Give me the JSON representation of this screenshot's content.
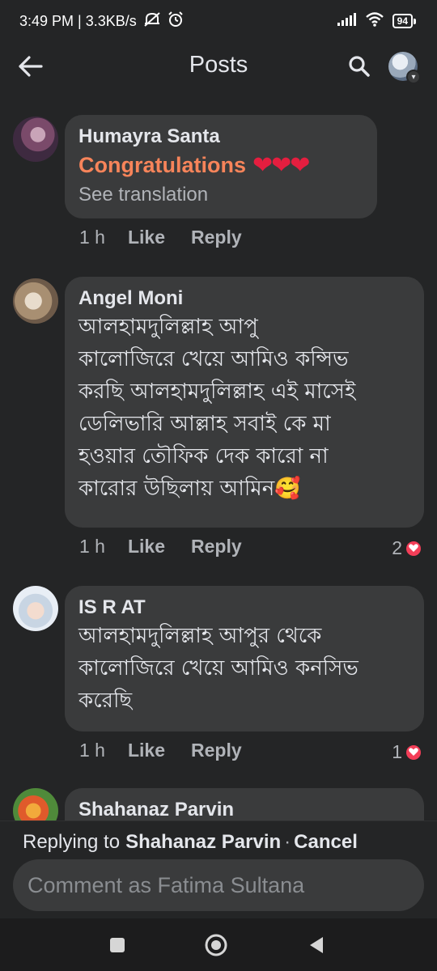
{
  "status_bar": {
    "time_speed": "3:49 PM | 3.3KB/s",
    "battery": "94"
  },
  "header": {
    "title": "Posts",
    "back_icon": "arrow-left-icon",
    "search_icon": "search-icon"
  },
  "comments": [
    {
      "author": "Humayra Santa",
      "text": "Congratulations",
      "hearts": "❤❤❤",
      "see_translation": "See translation",
      "time": "1 h",
      "like": "Like",
      "reply": "Reply"
    },
    {
      "author": "Angel Moni",
      "lines": [
        "আলহামদুলিল্লাহ আপু",
        "কালোজিরে খেয়ে আমিও কন্সিভ",
        "করছি আলহামদুলিল্লাহ এই মাসেই",
        "ডেলিভারি আল্লাহ সবাই কে মা",
        "হওয়ার তৌফিক দেক কারো না",
        "কারোর উছিলায় আমিন🥰"
      ],
      "time": "1 h",
      "like": "Like",
      "reply": "Reply",
      "reaction_count": "2"
    },
    {
      "author": "IS R AT",
      "lines": [
        "আলহামদুলিল্লাহ আপুর থেকে",
        "কালোজিরে খেয়ে আমিও কনসিভ",
        "করেছি"
      ],
      "time": "1 h",
      "like": "Like",
      "reply": "Reply",
      "reaction_count": "1"
    },
    {
      "author": "Shahanaz Parvin"
    }
  ],
  "reply_bar": {
    "prefix": "Replying to",
    "name": "Shahanaz Parvin",
    "separator": "·",
    "cancel": "Cancel"
  },
  "composer": {
    "placeholder": "Comment as Fatima Sultana"
  },
  "colors": {
    "background": "#242526",
    "bubble": "#3a3b3c",
    "highlight_text": "#f7845a",
    "heart": "#e41e3f"
  }
}
